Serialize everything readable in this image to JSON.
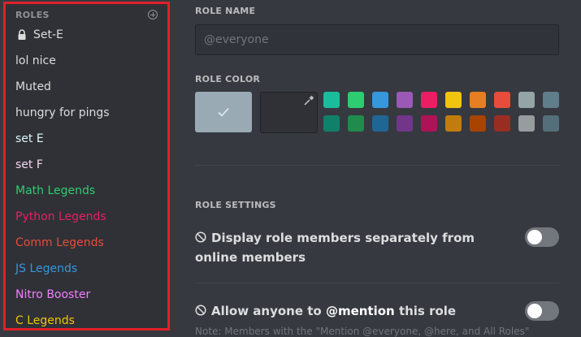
{
  "sidebar": {
    "header": "ROLES",
    "roles": [
      {
        "name": "Set-E",
        "color": "#dcddde",
        "locked": true
      },
      {
        "name": "lol nice",
        "color": "#dcddde"
      },
      {
        "name": "Muted",
        "color": "#dcddde"
      },
      {
        "name": "hungry for pings",
        "color": "#dcddde"
      },
      {
        "name": "set E",
        "color": "#dff6fb"
      },
      {
        "name": "set F",
        "color": "#f8d6f0"
      },
      {
        "name": "Math Legends",
        "color": "#2ecc71"
      },
      {
        "name": "Python Legends",
        "color": "#e91e63"
      },
      {
        "name": "Comm Legends",
        "color": "#e74c3c"
      },
      {
        "name": "JS Legends",
        "color": "#3498db"
      },
      {
        "name": "Nitro Booster",
        "color": "#f47fff"
      },
      {
        "name": "C Legends",
        "color": "#f1c40f"
      }
    ]
  },
  "main": {
    "role_name_label": "ROLE NAME",
    "role_name_value": "",
    "role_name_placeholder": "@everyone",
    "role_color_label": "ROLE COLOR",
    "default_color": "#99aab5",
    "swatches_row1": [
      "#1abc9c",
      "#2ecc71",
      "#3498db",
      "#9b59b6",
      "#e91e63",
      "#f1c40f",
      "#e67e22",
      "#e74c3c",
      "#95a5a6",
      "#607d8b"
    ],
    "swatches_row2": [
      "#11806a",
      "#1f8b4c",
      "#206694",
      "#71368a",
      "#ad1457",
      "#c27c0e",
      "#a84300",
      "#992d22",
      "#979c9f",
      "#546e7a"
    ],
    "role_settings_label": "ROLE SETTINGS",
    "setting1_text": "Display role members separately from online members",
    "setting1_enabled": false,
    "setting2_prefix": "Allow anyone to ",
    "setting2_mention": "@mention",
    "setting2_suffix": " this role",
    "setting2_enabled": false,
    "setting2_note": "Note: Members with the \"Mention @everyone, @here, and All Roles\""
  }
}
